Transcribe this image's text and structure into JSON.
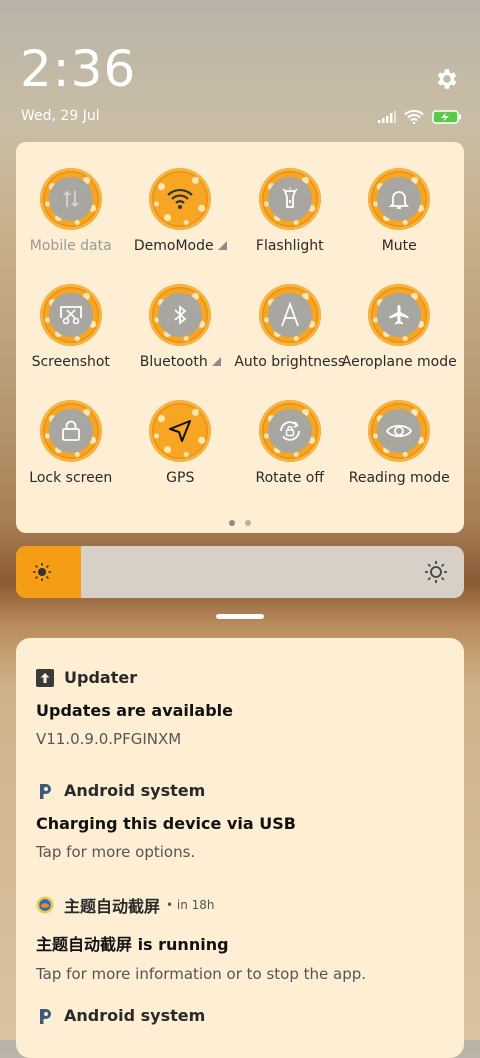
{
  "status": {
    "time": "2:36",
    "date": "Wed, 29 Jul"
  },
  "tiles": [
    {
      "label": "Mobile data",
      "icon": "mobile-data-icon",
      "disabled": true
    },
    {
      "label": "DemoMode",
      "icon": "wifi-icon",
      "active": true,
      "expandable": true
    },
    {
      "label": "Flashlight",
      "icon": "flashlight-icon"
    },
    {
      "label": "Mute",
      "icon": "bell-icon"
    },
    {
      "label": "Screenshot",
      "icon": "screenshot-icon"
    },
    {
      "label": "Bluetooth",
      "icon": "bluetooth-icon",
      "expandable": true
    },
    {
      "label": "Auto brightness",
      "icon": "auto-brightness-icon"
    },
    {
      "label": "Aeroplane mode",
      "icon": "airplane-icon"
    },
    {
      "label": "Lock screen",
      "icon": "lock-icon"
    },
    {
      "label": "GPS",
      "icon": "gps-icon",
      "active": true
    },
    {
      "label": "Rotate off",
      "icon": "rotate-lock-icon"
    },
    {
      "label": "Reading mode",
      "icon": "eye-icon"
    }
  ],
  "brightness": {
    "level": 0.145
  },
  "notifications": [
    {
      "app": "Updater",
      "icon": "updater-icon",
      "meta": "",
      "title": "Updates are available",
      "body": "V11.0.9.0.PFGINXM"
    },
    {
      "app": "Android system",
      "icon": "android-system-icon",
      "meta": "",
      "title": "Charging this device via USB",
      "body": "Tap for more options."
    },
    {
      "app": "主题自动截屏",
      "icon": "theme-app-icon",
      "meta": "• in 18h",
      "title": "主题自动截屏 is running",
      "body": "Tap for more information or to stop the app."
    },
    {
      "app": "Android system",
      "icon": "android-system-icon",
      "meta": "",
      "title": "",
      "body": ""
    }
  ],
  "colors": {
    "accent": "#f59d14",
    "panel": "#fdeed4"
  }
}
